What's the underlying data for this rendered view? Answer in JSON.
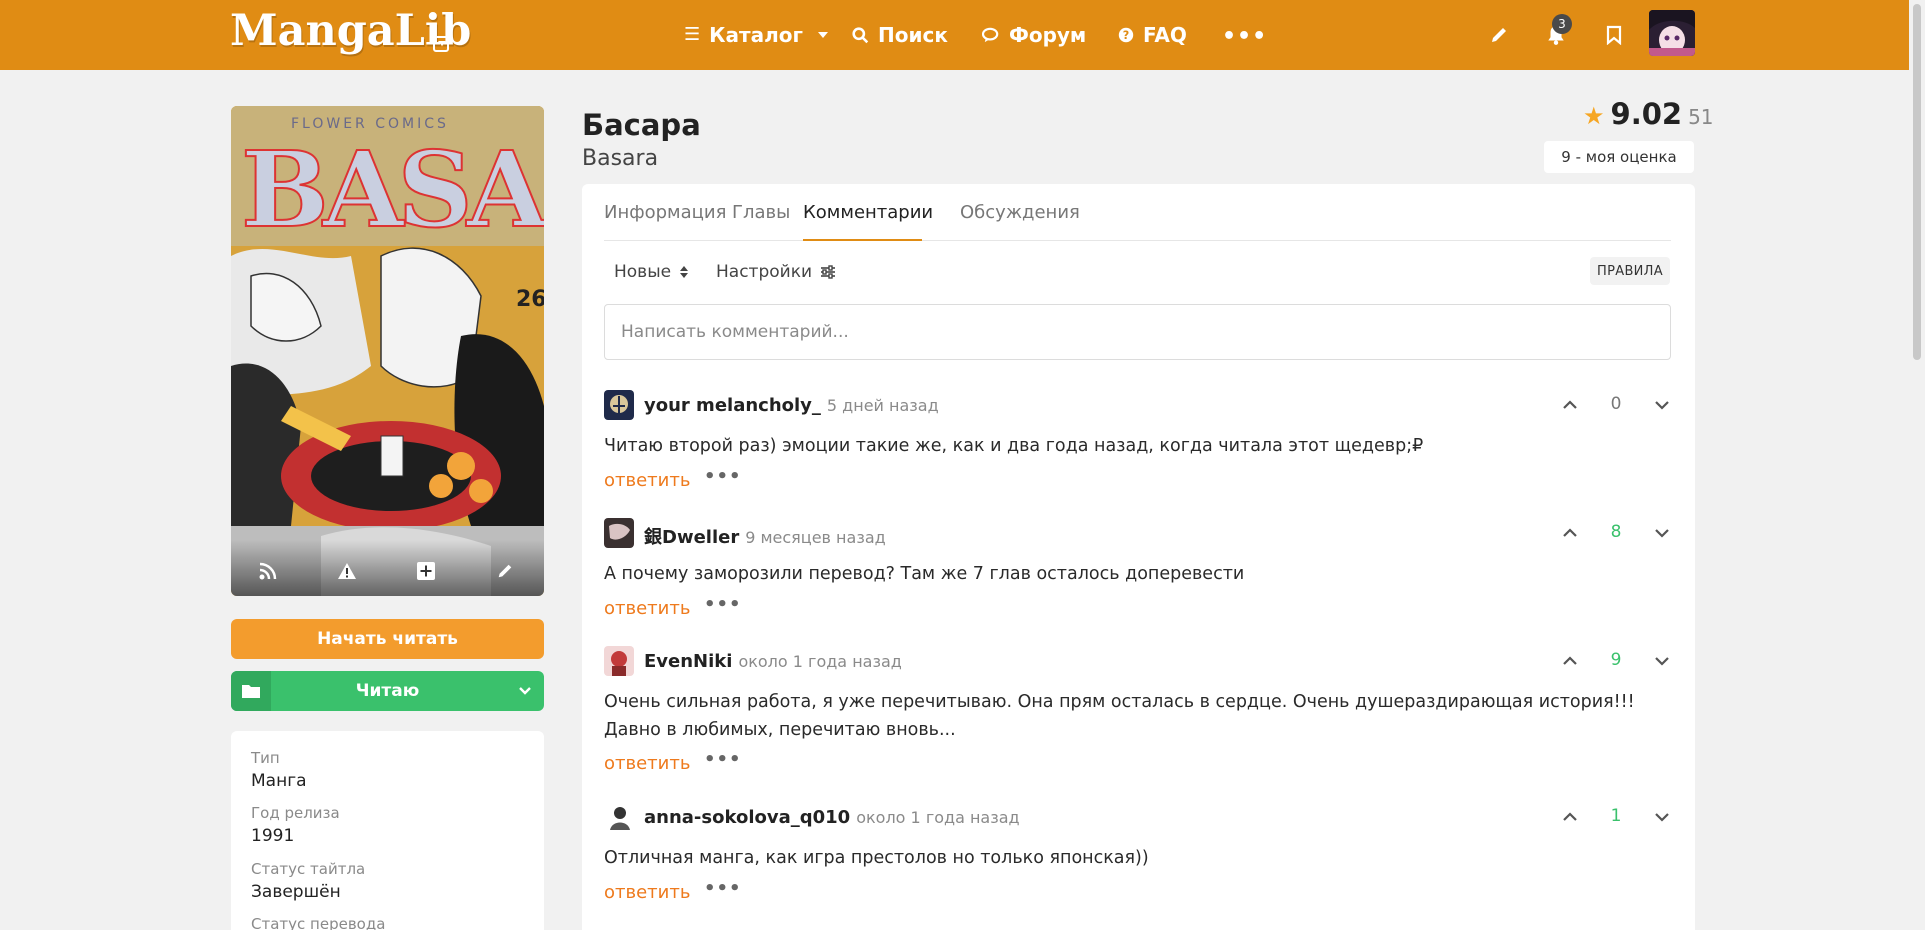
{
  "header": {
    "logo": "MangaLib",
    "nav": [
      {
        "label": "Каталог",
        "icon": "list-icon"
      },
      {
        "label": "Поиск",
        "icon": "search-icon"
      },
      {
        "label": "Форум",
        "icon": "chat-icon"
      },
      {
        "label": "FAQ",
        "icon": "question-icon"
      }
    ],
    "more_icon": "•••",
    "notifications_count": "3",
    "accent_color": "#e08c14"
  },
  "manga": {
    "title_ru": "Басара",
    "title_en": "Basara",
    "rating": "9.02",
    "rating_count": "51",
    "my_rating": "9 - моя оценка",
    "start_reading": "Начать читать",
    "list_status": "Читаю",
    "info": [
      {
        "label": "Тип",
        "value": "Манга"
      },
      {
        "label": "Год релиза",
        "value": "1991"
      },
      {
        "label": "Статус тайтла",
        "value": "Завершён"
      },
      {
        "label": "Статус перевода",
        "value": ""
      }
    ]
  },
  "tabs": [
    "Информация",
    "Главы",
    "Комментарии",
    "Обсуждения"
  ],
  "active_tab": "Комментарии",
  "comments_toolbar": {
    "sort_label": "Новые",
    "settings_label": "Настройки",
    "rules_label": "ПРАВИЛА",
    "input_placeholder": "Написать комментарий..."
  },
  "comments": [
    {
      "user": "your melancholy_",
      "time": "5 дней назад",
      "text": "Читаю второй раз) эмоции такие же, как и два года назад, когда читала этот щедевр;₽",
      "score": "0",
      "reply": "ответить"
    },
    {
      "user": "銀Dweller",
      "time": "9 месяцев назад",
      "text": "А почему заморозили перевод? Там же 7 глав осталось доперевести",
      "score": "8",
      "reply": "ответить"
    },
    {
      "user": "EvenNiki",
      "time": "около 1 года назад",
      "text": "Очень сильная работа, я уже перечитываю. Она прям осталась в сердце. Очень душераздирающая история!!! Давно в любимых, перечитаю вновь...",
      "score": "9",
      "reply": "ответить"
    },
    {
      "user": "anna-sokolova_q010",
      "time": "около 1 года назад",
      "text": "Отличная манга, как игра престолов но только японская))",
      "score": "1",
      "reply": "ответить"
    }
  ]
}
